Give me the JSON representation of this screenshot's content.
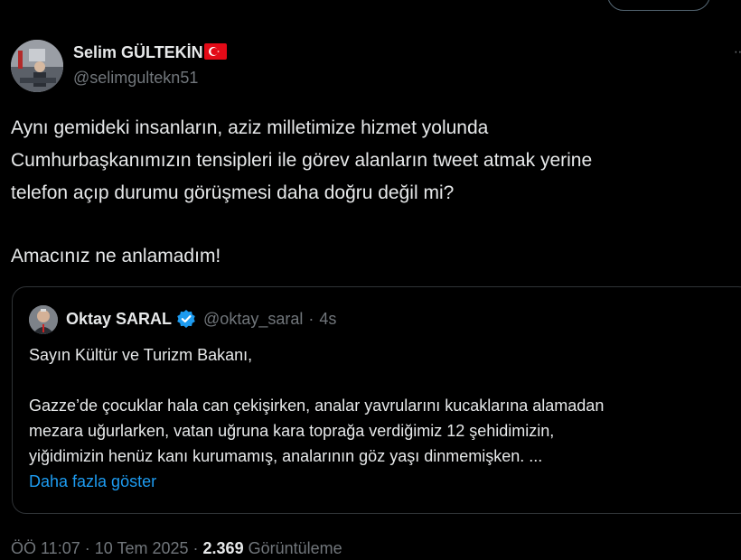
{
  "author": {
    "name": "Selim GÜLTEKİN",
    "handle": "@selimgultekn51",
    "flag_icon": "turkey-flag-icon"
  },
  "tweet": {
    "lines": [
      "Aynı gemideki insanların, aziz milletimize hizmet yolunda",
      "Cumhurbaşkanımızın tensipleri ile görev alanların tweet atmak yerine",
      "telefon açıp durumu görüşmesi daha doğru değil mi?"
    ],
    "closing": "Amacınız ne anlamadım!"
  },
  "quoted": {
    "name": "Oktay SARAL",
    "handle": "@oktay_saral",
    "separator": "·",
    "time": "4s",
    "greeting": "Sayın Kültür ve Turizm Bakanı,",
    "lines": [
      "Gazze’de çocuklar hala can çekişirken, analar yavrularını kucaklarına alamadan",
      "mezara uğurlarken, vatan uğruna kara toprağa verdiğimiz 12 şehidimizin,",
      "yiğidimizin henüz kanı kurumamış, analarının göz yaşı dinmemişken. ..."
    ],
    "show_more": "Daha fazla göster"
  },
  "footer": {
    "time": "ÖÖ 11:07",
    "sep1": "·",
    "date": "10 Tem 2025",
    "sep2": "·",
    "views": "2.369",
    "views_label": "Görüntüleme"
  },
  "colors": {
    "background": "#000000",
    "text": "#e7e9ea",
    "muted": "#71767b",
    "link": "#1d9bf0",
    "border": "#2f3336"
  }
}
